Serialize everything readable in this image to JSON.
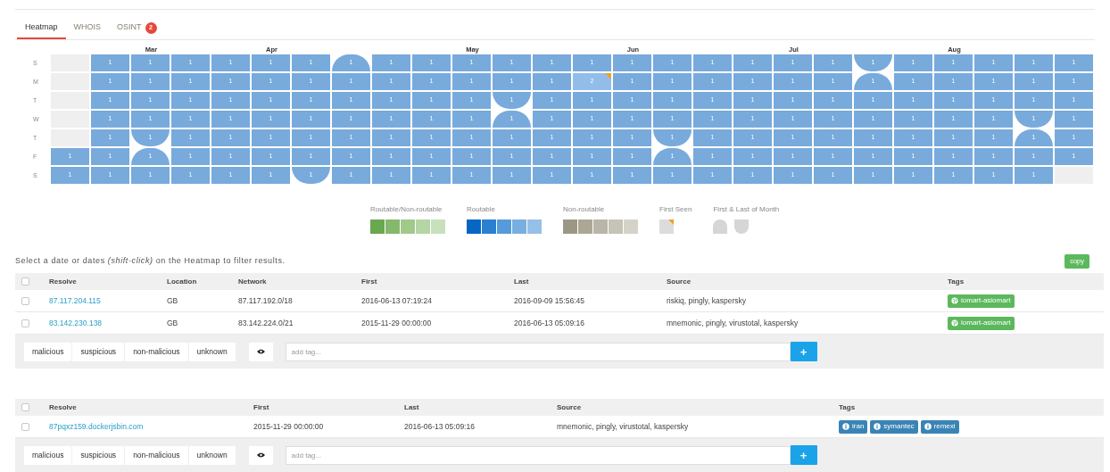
{
  "tabs": [
    {
      "label": "Heatmap",
      "selected": true
    },
    {
      "label": "WHOIS",
      "selected": false
    },
    {
      "label": "OSINT",
      "selected": false,
      "badge": "2"
    }
  ],
  "heatmap": {
    "day_labels": [
      "S",
      "M",
      "T",
      "W",
      "T",
      "F",
      "S"
    ],
    "weeks": [
      {
        "days": [
          {
            "kind": "empty"
          },
          {
            "kind": "empty"
          },
          {
            "kind": "empty"
          },
          {
            "kind": "empty"
          },
          {
            "kind": "empty"
          },
          {
            "kind": "day",
            "count": "1",
            "color": "#78aadc"
          },
          {
            "kind": "day",
            "count": "1",
            "color": "#78aadc"
          }
        ]
      },
      {
        "days": [
          {
            "kind": "day",
            "count": "1",
            "color": "#78aadc"
          },
          {
            "kind": "day",
            "count": "1",
            "color": "#78aadc"
          },
          {
            "kind": "day",
            "count": "1",
            "color": "#78aadc"
          },
          {
            "kind": "day",
            "count": "1",
            "color": "#78aadc"
          },
          {
            "kind": "day",
            "count": "1",
            "color": "#78aadc"
          },
          {
            "kind": "day",
            "count": "1",
            "color": "#78aadc"
          },
          {
            "kind": "day",
            "count": "1",
            "color": "#78aadc"
          }
        ]
      },
      {
        "month": "Mar",
        "days": [
          {
            "kind": "day",
            "count": "1",
            "color": "#78aadc"
          },
          {
            "kind": "day",
            "count": "1",
            "color": "#78aadc"
          },
          {
            "kind": "day",
            "count": "1",
            "color": "#78aadc"
          },
          {
            "kind": "day",
            "count": "1",
            "color": "#78aadc"
          },
          {
            "kind": "last_of_month",
            "count": "1",
            "color": "#78aadc"
          },
          {
            "kind": "first_of_month",
            "count": "1",
            "color": "#78aadc"
          },
          {
            "kind": "day",
            "count": "1",
            "color": "#78aadc"
          }
        ]
      },
      {
        "days": [
          {
            "kind": "day",
            "count": "1",
            "color": "#78aadc"
          },
          {
            "kind": "day",
            "count": "1",
            "color": "#78aadc"
          },
          {
            "kind": "day",
            "count": "1",
            "color": "#78aadc"
          },
          {
            "kind": "day",
            "count": "1",
            "color": "#78aadc"
          },
          {
            "kind": "day",
            "count": "1",
            "color": "#78aadc"
          },
          {
            "kind": "day",
            "count": "1",
            "color": "#78aadc"
          },
          {
            "kind": "day",
            "count": "1",
            "color": "#78aadc"
          }
        ]
      },
      {
        "days": [
          {
            "kind": "day",
            "count": "1",
            "color": "#78aadc"
          },
          {
            "kind": "day",
            "count": "1",
            "color": "#78aadc"
          },
          {
            "kind": "day",
            "count": "1",
            "color": "#78aadc"
          },
          {
            "kind": "day",
            "count": "1",
            "color": "#78aadc"
          },
          {
            "kind": "day",
            "count": "1",
            "color": "#78aadc"
          },
          {
            "kind": "day",
            "count": "1",
            "color": "#78aadc"
          },
          {
            "kind": "day",
            "count": "1",
            "color": "#78aadc"
          }
        ]
      },
      {
        "month": "Apr",
        "days": [
          {
            "kind": "day",
            "count": "1",
            "color": "#78aadc"
          },
          {
            "kind": "day",
            "count": "1",
            "color": "#78aadc"
          },
          {
            "kind": "day",
            "count": "1",
            "color": "#78aadc"
          },
          {
            "kind": "day",
            "count": "1",
            "color": "#78aadc"
          },
          {
            "kind": "day",
            "count": "1",
            "color": "#78aadc"
          },
          {
            "kind": "day",
            "count": "1",
            "color": "#78aadc"
          },
          {
            "kind": "day",
            "count": "1",
            "color": "#78aadc"
          }
        ]
      },
      {
        "days": [
          {
            "kind": "day",
            "count": "1",
            "color": "#78aadc"
          },
          {
            "kind": "day",
            "count": "1",
            "color": "#78aadc"
          },
          {
            "kind": "day",
            "count": "1",
            "color": "#78aadc"
          },
          {
            "kind": "day",
            "count": "1",
            "color": "#78aadc"
          },
          {
            "kind": "day",
            "count": "1",
            "color": "#78aadc"
          },
          {
            "kind": "day",
            "count": "1",
            "color": "#78aadc"
          },
          {
            "kind": "last_of_month",
            "count": "1",
            "color": "#78aadc"
          }
        ]
      },
      {
        "days": [
          {
            "kind": "first_of_month",
            "count": "1",
            "color": "#78aadc"
          },
          {
            "kind": "day",
            "count": "1",
            "color": "#78aadc"
          },
          {
            "kind": "day",
            "count": "1",
            "color": "#78aadc"
          },
          {
            "kind": "day",
            "count": "1",
            "color": "#78aadc"
          },
          {
            "kind": "day",
            "count": "1",
            "color": "#78aadc"
          },
          {
            "kind": "day",
            "count": "1",
            "color": "#78aadc"
          },
          {
            "kind": "day",
            "count": "1",
            "color": "#78aadc"
          }
        ]
      },
      {
        "days": [
          {
            "kind": "day",
            "count": "1",
            "color": "#78aadc"
          },
          {
            "kind": "day",
            "count": "1",
            "color": "#78aadc"
          },
          {
            "kind": "day",
            "count": "1",
            "color": "#78aadc"
          },
          {
            "kind": "day",
            "count": "1",
            "color": "#78aadc"
          },
          {
            "kind": "day",
            "count": "1",
            "color": "#78aadc"
          },
          {
            "kind": "day",
            "count": "1",
            "color": "#78aadc"
          },
          {
            "kind": "day",
            "count": "1",
            "color": "#78aadc"
          }
        ]
      },
      {
        "days": [
          {
            "kind": "day",
            "count": "1",
            "color": "#78aadc"
          },
          {
            "kind": "day",
            "count": "1",
            "color": "#78aadc"
          },
          {
            "kind": "day",
            "count": "1",
            "color": "#78aadc"
          },
          {
            "kind": "day",
            "count": "1",
            "color": "#78aadc"
          },
          {
            "kind": "day",
            "count": "1",
            "color": "#78aadc"
          },
          {
            "kind": "day",
            "count": "1",
            "color": "#78aadc"
          },
          {
            "kind": "day",
            "count": "1",
            "color": "#78aadc"
          }
        ]
      },
      {
        "month": "May",
        "days": [
          {
            "kind": "day",
            "count": "1",
            "color": "#78aadc"
          },
          {
            "kind": "day",
            "count": "1",
            "color": "#78aadc"
          },
          {
            "kind": "day",
            "count": "1",
            "color": "#78aadc"
          },
          {
            "kind": "day",
            "count": "1",
            "color": "#78aadc"
          },
          {
            "kind": "day",
            "count": "1",
            "color": "#78aadc"
          },
          {
            "kind": "day",
            "count": "1",
            "color": "#78aadc"
          },
          {
            "kind": "day",
            "count": "1",
            "color": "#78aadc"
          }
        ]
      },
      {
        "days": [
          {
            "kind": "day",
            "count": "1",
            "color": "#78aadc"
          },
          {
            "kind": "day",
            "count": "1",
            "color": "#78aadc"
          },
          {
            "kind": "last_of_month",
            "count": "1",
            "color": "#78aadc"
          },
          {
            "kind": "first_of_month",
            "count": "1",
            "color": "#78aadc"
          },
          {
            "kind": "day",
            "count": "1",
            "color": "#78aadc"
          },
          {
            "kind": "day",
            "count": "1",
            "color": "#78aadc"
          },
          {
            "kind": "day",
            "count": "1",
            "color": "#78aadc"
          }
        ]
      },
      {
        "days": [
          {
            "kind": "day",
            "count": "1",
            "color": "#78aadc"
          },
          {
            "kind": "day",
            "count": "1",
            "color": "#78aadc"
          },
          {
            "kind": "day",
            "count": "1",
            "color": "#78aadc"
          },
          {
            "kind": "day",
            "count": "1",
            "color": "#78aadc"
          },
          {
            "kind": "day",
            "count": "1",
            "color": "#78aadc"
          },
          {
            "kind": "day",
            "count": "1",
            "color": "#78aadc"
          },
          {
            "kind": "day",
            "count": "1",
            "color": "#78aadc"
          }
        ]
      },
      {
        "days": [
          {
            "kind": "day",
            "count": "1",
            "color": "#78aadc"
          },
          {
            "kind": "first_seen",
            "count": "2",
            "color": "#92bde8"
          },
          {
            "kind": "day",
            "count": "1",
            "color": "#78aadc"
          },
          {
            "kind": "day",
            "count": "1",
            "color": "#78aadc"
          },
          {
            "kind": "day",
            "count": "1",
            "color": "#78aadc"
          },
          {
            "kind": "day",
            "count": "1",
            "color": "#78aadc"
          },
          {
            "kind": "day",
            "count": "1",
            "color": "#78aadc"
          }
        ]
      },
      {
        "month": "Jun",
        "days": [
          {
            "kind": "day",
            "count": "1",
            "color": "#78aadc"
          },
          {
            "kind": "day",
            "count": "1",
            "color": "#78aadc"
          },
          {
            "kind": "day",
            "count": "1",
            "color": "#78aadc"
          },
          {
            "kind": "day",
            "count": "1",
            "color": "#78aadc"
          },
          {
            "kind": "day",
            "count": "1",
            "color": "#78aadc"
          },
          {
            "kind": "day",
            "count": "1",
            "color": "#78aadc"
          },
          {
            "kind": "day",
            "count": "1",
            "color": "#78aadc"
          }
        ]
      },
      {
        "days": [
          {
            "kind": "day",
            "count": "1",
            "color": "#78aadc"
          },
          {
            "kind": "day",
            "count": "1",
            "color": "#78aadc"
          },
          {
            "kind": "day",
            "count": "1",
            "color": "#78aadc"
          },
          {
            "kind": "day",
            "count": "1",
            "color": "#78aadc"
          },
          {
            "kind": "last_of_month",
            "count": "1",
            "color": "#78aadc"
          },
          {
            "kind": "first_of_month",
            "count": "1",
            "color": "#78aadc"
          },
          {
            "kind": "day",
            "count": "1",
            "color": "#78aadc"
          }
        ]
      },
      {
        "days": [
          {
            "kind": "day",
            "count": "1",
            "color": "#78aadc"
          },
          {
            "kind": "day",
            "count": "1",
            "color": "#78aadc"
          },
          {
            "kind": "day",
            "count": "1",
            "color": "#78aadc"
          },
          {
            "kind": "day",
            "count": "1",
            "color": "#78aadc"
          },
          {
            "kind": "day",
            "count": "1",
            "color": "#78aadc"
          },
          {
            "kind": "day",
            "count": "1",
            "color": "#78aadc"
          },
          {
            "kind": "day",
            "count": "1",
            "color": "#78aadc"
          }
        ]
      },
      {
        "days": [
          {
            "kind": "day",
            "count": "1",
            "color": "#78aadc"
          },
          {
            "kind": "day",
            "count": "1",
            "color": "#78aadc"
          },
          {
            "kind": "day",
            "count": "1",
            "color": "#78aadc"
          },
          {
            "kind": "day",
            "count": "1",
            "color": "#78aadc"
          },
          {
            "kind": "day",
            "count": "1",
            "color": "#78aadc"
          },
          {
            "kind": "day",
            "count": "1",
            "color": "#78aadc"
          },
          {
            "kind": "day",
            "count": "1",
            "color": "#78aadc"
          }
        ]
      },
      {
        "month": "Jul",
        "days": [
          {
            "kind": "day",
            "count": "1",
            "color": "#78aadc"
          },
          {
            "kind": "day",
            "count": "1",
            "color": "#78aadc"
          },
          {
            "kind": "day",
            "count": "1",
            "color": "#78aadc"
          },
          {
            "kind": "day",
            "count": "1",
            "color": "#78aadc"
          },
          {
            "kind": "day",
            "count": "1",
            "color": "#78aadc"
          },
          {
            "kind": "day",
            "count": "1",
            "color": "#78aadc"
          },
          {
            "kind": "day",
            "count": "1",
            "color": "#78aadc"
          }
        ]
      },
      {
        "days": [
          {
            "kind": "day",
            "count": "1",
            "color": "#78aadc"
          },
          {
            "kind": "day",
            "count": "1",
            "color": "#78aadc"
          },
          {
            "kind": "day",
            "count": "1",
            "color": "#78aadc"
          },
          {
            "kind": "day",
            "count": "1",
            "color": "#78aadc"
          },
          {
            "kind": "day",
            "count": "1",
            "color": "#78aadc"
          },
          {
            "kind": "day",
            "count": "1",
            "color": "#78aadc"
          },
          {
            "kind": "day",
            "count": "1",
            "color": "#78aadc"
          }
        ]
      },
      {
        "days": [
          {
            "kind": "last_of_month",
            "count": "1",
            "color": "#78aadc"
          },
          {
            "kind": "first_of_month",
            "count": "1",
            "color": "#78aadc"
          },
          {
            "kind": "day",
            "count": "1",
            "color": "#78aadc"
          },
          {
            "kind": "day",
            "count": "1",
            "color": "#78aadc"
          },
          {
            "kind": "day",
            "count": "1",
            "color": "#78aadc"
          },
          {
            "kind": "day",
            "count": "1",
            "color": "#78aadc"
          },
          {
            "kind": "day",
            "count": "1",
            "color": "#78aadc"
          }
        ]
      },
      {
        "days": [
          {
            "kind": "day",
            "count": "1",
            "color": "#78aadc"
          },
          {
            "kind": "day",
            "count": "1",
            "color": "#78aadc"
          },
          {
            "kind": "day",
            "count": "1",
            "color": "#78aadc"
          },
          {
            "kind": "day",
            "count": "1",
            "color": "#78aadc"
          },
          {
            "kind": "day",
            "count": "1",
            "color": "#78aadc"
          },
          {
            "kind": "day",
            "count": "1",
            "color": "#78aadc"
          },
          {
            "kind": "day",
            "count": "1",
            "color": "#78aadc"
          }
        ]
      },
      {
        "month": "Aug",
        "days": [
          {
            "kind": "day",
            "count": "1",
            "color": "#78aadc"
          },
          {
            "kind": "day",
            "count": "1",
            "color": "#78aadc"
          },
          {
            "kind": "day",
            "count": "1",
            "color": "#78aadc"
          },
          {
            "kind": "day",
            "count": "1",
            "color": "#78aadc"
          },
          {
            "kind": "day",
            "count": "1",
            "color": "#78aadc"
          },
          {
            "kind": "day",
            "count": "1",
            "color": "#78aadc"
          },
          {
            "kind": "day",
            "count": "1",
            "color": "#78aadc"
          }
        ]
      },
      {
        "days": [
          {
            "kind": "day",
            "count": "1",
            "color": "#78aadc"
          },
          {
            "kind": "day",
            "count": "1",
            "color": "#78aadc"
          },
          {
            "kind": "day",
            "count": "1",
            "color": "#78aadc"
          },
          {
            "kind": "day",
            "count": "1",
            "color": "#78aadc"
          },
          {
            "kind": "day",
            "count": "1",
            "color": "#78aadc"
          },
          {
            "kind": "day",
            "count": "1",
            "color": "#78aadc"
          },
          {
            "kind": "day",
            "count": "1",
            "color": "#78aadc"
          }
        ]
      },
      {
        "days": [
          {
            "kind": "day",
            "count": "1",
            "color": "#78aadc"
          },
          {
            "kind": "day",
            "count": "1",
            "color": "#78aadc"
          },
          {
            "kind": "day",
            "count": "1",
            "color": "#78aadc"
          },
          {
            "kind": "last_of_month",
            "count": "1",
            "color": "#78aadc"
          },
          {
            "kind": "first_of_month",
            "count": "1",
            "color": "#78aadc"
          },
          {
            "kind": "day",
            "count": "1",
            "color": "#78aadc"
          },
          {
            "kind": "day",
            "count": "1",
            "color": "#78aadc"
          }
        ]
      },
      {
        "days": [
          {
            "kind": "day",
            "count": "1",
            "color": "#78aadc"
          },
          {
            "kind": "day",
            "count": "1",
            "color": "#78aadc"
          },
          {
            "kind": "day",
            "count": "1",
            "color": "#78aadc"
          },
          {
            "kind": "day",
            "count": "1",
            "color": "#78aadc"
          },
          {
            "kind": "day",
            "count": "1",
            "color": "#78aadc"
          },
          {
            "kind": "day",
            "count": "1",
            "color": "#78aadc"
          },
          {
            "kind": "empty"
          }
        ]
      }
    ]
  },
  "legend": [
    {
      "kind": "scale",
      "title": "Routable/Non-routable",
      "swatches": [
        {
          "color": "#6aa84f"
        },
        {
          "color": "#84b86c"
        },
        {
          "color": "#a0c98a"
        },
        {
          "color": "#b5d5a5"
        },
        {
          "color": "#c8e0bc"
        }
      ]
    },
    {
      "kind": "scale",
      "title": "Routable",
      "swatches": [
        {
          "color": "#0566c4"
        },
        {
          "color": "#2b80d0"
        },
        {
          "color": "#559bdb"
        },
        {
          "color": "#78aee0"
        },
        {
          "color": "#95c0e8"
        }
      ]
    },
    {
      "kind": "scale",
      "title": "Non-routable",
      "swatches": [
        {
          "color": "#9c9784"
        },
        {
          "color": "#aca795"
        },
        {
          "color": "#b9b5a7"
        },
        {
          "color": "#c6c3b7"
        },
        {
          "color": "#d5d3c9"
        }
      ]
    },
    {
      "kind": "first_seen",
      "title": "First Seen"
    },
    {
      "kind": "month_ends",
      "title": "First & Last of Month"
    }
  ],
  "hint": "Select a date or dates *(shift-click)* on the Heatmap to filter results.",
  "copy_button": "copy",
  "tables": [
    {
      "columns": [
        "Resolve",
        "Location",
        "Network",
        "First",
        "Last",
        "Source",
        "Tags"
      ],
      "all_checked": false,
      "rows": [
        {
          "checked": false,
          "cells": [
            "87.117.204.115",
            "GB",
            "87.117.192.0/18",
            "2016-06-13 07:19:24",
            "2016-09-09 15:56:45",
            "riskiq, pingly, kaspersky"
          ],
          "tags": [
            {
              "label": "iomart-asiomart",
              "kind": "globe",
              "color": "#5cb85c"
            }
          ]
        },
        {
          "checked": false,
          "cells": [
            "83.142.230.138",
            "GB",
            "83.142.224.0/21",
            "2015-11-29 00:00:00",
            "2016-06-13 05:09:16",
            "mnemonic, pingly, virustotal, kaspersky"
          ],
          "tags": [
            {
              "label": "iomart-asiomart",
              "kind": "globe",
              "color": "#5cb85c"
            }
          ]
        }
      ],
      "actions": {
        "verdicts": [
          "malicious",
          "suspicious",
          "non-malicious",
          "unknown"
        ],
        "tag_placeholder": "add tag...",
        "add_button": "+"
      }
    },
    {
      "columns": [
        "Resolve",
        "First",
        "Last",
        "Source",
        "Tags"
      ],
      "all_checked": false,
      "rows": [
        {
          "checked": false,
          "cells": [
            "87pqxz159.dockerjsbin.com",
            "2015-11-29 00:00:00",
            "2016-06-13 05:09:16",
            "mnemonic, pingly, virustotal, kaspersky"
          ],
          "tags": [
            {
              "label": "iran",
              "kind": "info",
              "color": "#3a84b5"
            },
            {
              "label": "symantec",
              "kind": "info",
              "color": "#3a84b5"
            },
            {
              "label": "remexi",
              "kind": "info",
              "color": "#3a84b5"
            }
          ]
        }
      ],
      "actions": {
        "verdicts": [
          "malicious",
          "suspicious",
          "non-malicious",
          "unknown"
        ],
        "tag_placeholder": "add tag...",
        "add_button": "+"
      }
    }
  ]
}
